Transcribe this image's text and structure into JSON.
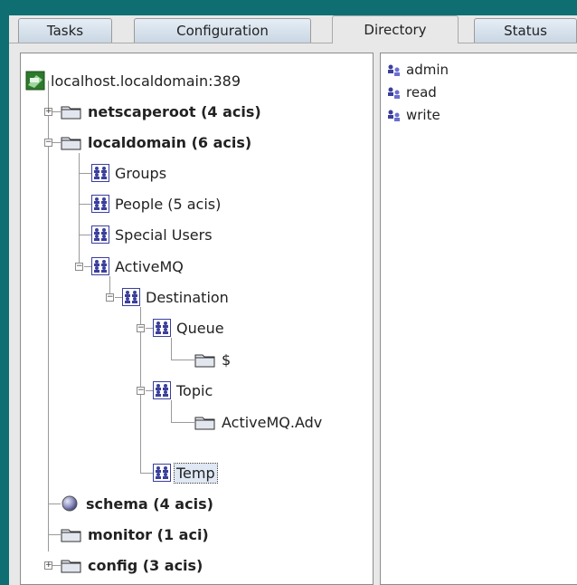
{
  "tabs": [
    {
      "label": "Tasks"
    },
    {
      "label": "Configuration"
    },
    {
      "label": "Directory"
    },
    {
      "label": "Status"
    }
  ],
  "active_tab": "Directory",
  "tree": {
    "root": "localhost.localdomain:389",
    "netscaperoot": "netscaperoot  (4 acis)",
    "localdomain": "localdomain  (6 acis)",
    "groups": "Groups",
    "people": "People  (5 acis)",
    "special_users": "Special Users",
    "activemq": "ActiveMQ",
    "destination": "Destination",
    "queue": "Queue",
    "dollar": "$",
    "topic": "Topic",
    "activemq_adv": "ActiveMQ.Adv",
    "temp": "Temp",
    "schema": "schema  (4 acis)",
    "monitor": "monitor  (1 aci)",
    "config": "config  (3 acis)"
  },
  "list": {
    "items": [
      "admin",
      "read",
      "write"
    ]
  },
  "colors": {
    "desktop": "#0e6e72",
    "folder": "#dfe3ea",
    "ou_icon": "#3b3f9c",
    "selection": "#dfe8f4"
  }
}
